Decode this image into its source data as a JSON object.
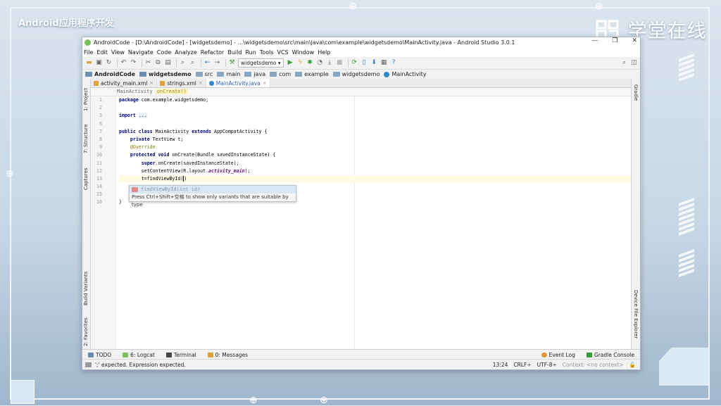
{
  "course_title": "Android应用程序开发",
  "brand": "学堂在线",
  "window": {
    "title": "AndroidCode - [D:\\AndroidCode] - [widgetsdemo] - ...\\widgetsdemo\\src\\main\\java\\com\\example\\widgetsdemo\\MainActivity.java - Android Studio 3.0.1",
    "controls": [
      "—",
      "❐",
      "✕"
    ]
  },
  "menu": [
    "File",
    "Edit",
    "View",
    "Navigate",
    "Code",
    "Analyze",
    "Refactor",
    "Build",
    "Run",
    "Tools",
    "VCS",
    "Window",
    "Help"
  ],
  "toolbar": {
    "run_config": "widgetsdemo"
  },
  "navbar": [
    "AndroidCode",
    "widgetsdemo",
    "src",
    "main",
    "java",
    "com",
    "example",
    "widgetsdemo",
    "MainActivity"
  ],
  "left_tools": [
    "1: Project",
    "7: Structure",
    "Captures",
    "Build Variants",
    "2: Favorites"
  ],
  "right_tools": [
    "Gradle",
    "Device File Explorer"
  ],
  "tabs": [
    {
      "label": "activity_main.xml",
      "active": false
    },
    {
      "label": "strings.xml",
      "active": false
    },
    {
      "label": "MainActivity.java",
      "active": true
    }
  ],
  "editor_breadcrumb": {
    "class": "MainActivity",
    "method": "onCreate()"
  },
  "code_lines": [
    {
      "n": "1",
      "text": "package com.example.widgetsdemo;"
    },
    {
      "n": "2",
      "text": ""
    },
    {
      "n": "3",
      "text": "import ..."
    },
    {
      "n": "6",
      "text": ""
    },
    {
      "n": "7",
      "text": "public class MainActivity extends AppCompatActivity {"
    },
    {
      "n": "8",
      "text": "    private TextView t;"
    },
    {
      "n": "9",
      "text": "    @Override"
    },
    {
      "n": "10",
      "text": "    protected void onCreate(Bundle savedInstanceState) {"
    },
    {
      "n": "11",
      "text": "        super.onCreate(savedInstanceState);"
    },
    {
      "n": "12",
      "text": "        setContentView(R.layout.activity_main);"
    },
    {
      "n": "13",
      "text": "        t=findViewById()"
    },
    {
      "n": "14",
      "text": "    }"
    },
    {
      "n": "15",
      "text": "}"
    },
    {
      "n": "16",
      "text": ""
    }
  ],
  "completion": {
    "item": "findViewById(int id)",
    "hint": "Press Ctrl+Shift+空格 to show only variants that are suitable by type"
  },
  "bottom_tools": [
    "TODO",
    "6: Logcat",
    "Terminal",
    "0: Messages",
    "Event Log",
    "Gradle Console"
  ],
  "status": {
    "message": "';' expected. Expression expected.",
    "position": "13:24",
    "line_sep": "CRLF÷",
    "encoding": "UTF-8÷",
    "context": "Context: <no context>"
  }
}
